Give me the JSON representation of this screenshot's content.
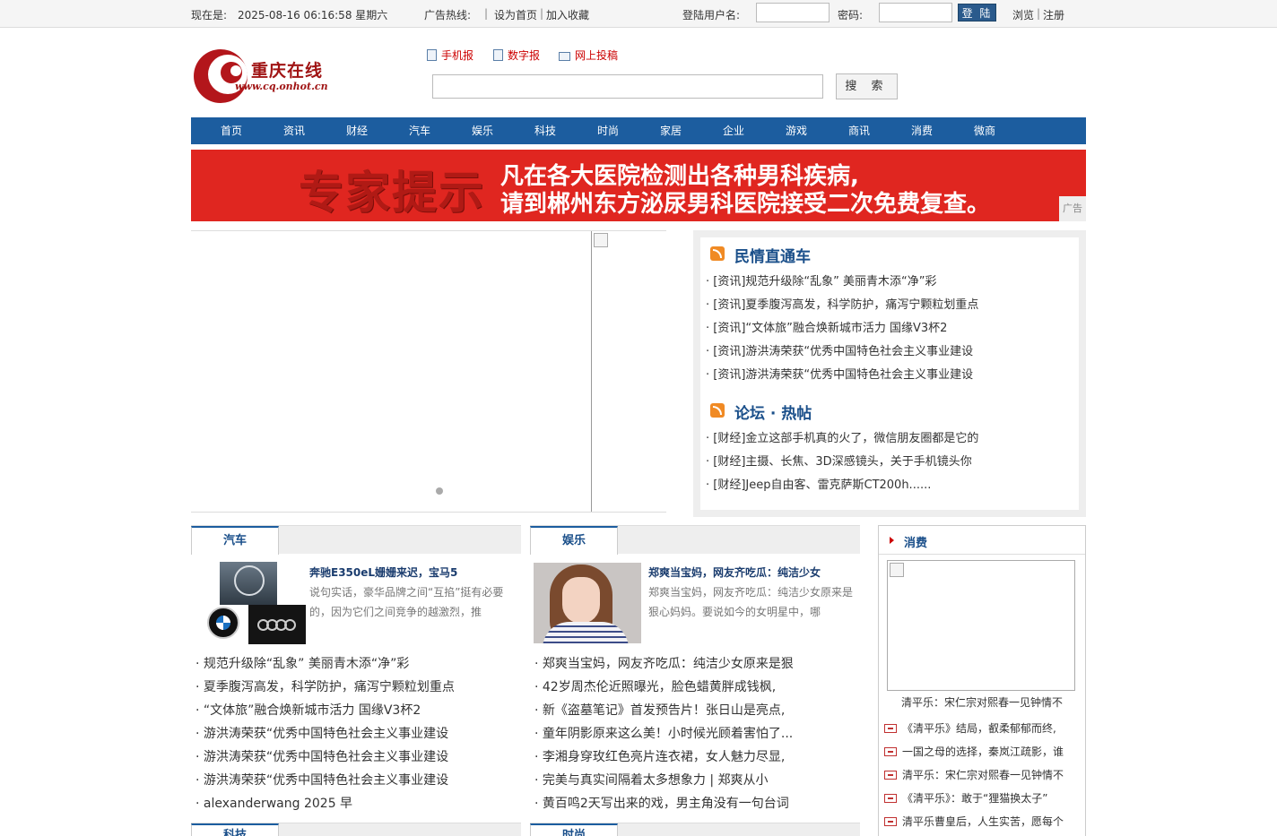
{
  "topbar": {
    "now_label": "现在是:",
    "datetime": "2025-08-16 06:16:58 星期六",
    "hotline_label": "广告热线:",
    "pipe": "|",
    "set_home": "设为首页",
    "pipe2": "|",
    "add_fav": "加入收藏",
    "username_label": "登陆用户名:",
    "username_value": "",
    "password_label": "密码:",
    "password_value": "",
    "login_button": "登 陆",
    "browse": "浏览",
    "pipe3": "|",
    "register": "注册"
  },
  "header": {
    "logo_text": "重庆在线",
    "logo_url": "www.cq.onhot.cn",
    "links": [
      {
        "label": "手机报",
        "icon": "phone-icon"
      },
      {
        "label": "数字报",
        "icon": "newspaper-icon"
      },
      {
        "label": "网上投稿",
        "icon": "mail-icon"
      }
    ],
    "search_value": "",
    "search_button": "搜 索"
  },
  "nav": [
    "首页",
    "资讯",
    "财经",
    "汽车",
    "娱乐",
    "科技",
    "时尚",
    "家居",
    "企业",
    "游戏",
    "商讯",
    "消费",
    "微商"
  ],
  "banner": {
    "big": "专家提示",
    "line1": "凡在各大医院检测出各种男科疾病,",
    "line2": "请到郴州东方泌尿男科医院接受二次免费复查。",
    "ad_tag": "广告"
  },
  "minqing": {
    "title": "民情直通车",
    "items": [
      "· [资讯]规范升级除“乱象” 美丽青木添“净”彩",
      "· [资讯]夏季腹泻高发，科学防护，痛泻宁颗粒划重点",
      "· [资讯]“文体旅”融合焕新城市活力 国缘V3杯2",
      "· [资讯]游洪涛荣获“优秀中国特色社会主义事业建设",
      "· [资讯]游洪涛荣获“优秀中国特色社会主义事业建设"
    ]
  },
  "luntan": {
    "title": "论坛 · 热帖",
    "items": [
      "· [财经]金立这部手机真的火了，微信朋友圈都是它的",
      "· [财经]主摄、长焦、3D深感镜头，关于手机镜头你",
      "· [财经]Jeep自由客、雷克萨斯CT200h......"
    ]
  },
  "qiche": {
    "tab": "汽车",
    "feature_title": "奔驰E350eL姗姗来迟，宝马5",
    "feature_desc": "说句实话，豪华品牌之间“互掐”挺有必要的，因为它们之间竞争的越激烈，推",
    "items": [
      "· 规范升级除“乱象” 美丽青木添“净”彩",
      "· 夏季腹泻高发，科学防护，痛泻宁颗粒划重点",
      "· “文体旅”融合焕新城市活力 国缘V3杯2",
      "· 游洪涛荣获“优秀中国特色社会主义事业建设",
      "· 游洪涛荣获“优秀中国特色社会主义事业建设",
      "· 游洪涛荣获“优秀中国特色社会主义事业建设",
      "· alexanderwang 2025 早"
    ]
  },
  "yule": {
    "tab": "娱乐",
    "feature_title": "郑爽当宝妈，网友齐吃瓜：纯洁少女",
    "feature_desc": "郑爽当宝妈，网友齐吃瓜：纯洁少女原来是狠心妈妈。要说如今的女明星中，哪",
    "items": [
      "· 郑爽当宝妈，网友齐吃瓜：纯洁少女原来是狠",
      "· 42岁周杰伦近照曝光，脸色蜡黄胖成钱枫,",
      "· 新《盗墓笔记》首发预告片！张日山是亮点,",
      "· 童年阴影原来这么美！小时候光顾着害怕了...",
      "· 李湘身穿玫红色亮片连衣裙，女人魅力尽显,",
      "· 完美与真实间隔着太多想象力 | 郑爽从小",
      "· 黄百鸣2天写出来的戏，男主角没有一句台词"
    ]
  },
  "xiaofei": {
    "title": "消费",
    "caption": "清平乐：宋仁宗对熙春一见钟情不",
    "items": [
      "《清平乐》结局，叡柔郁郁而终,",
      "一国之母的选择，秦岚江疏影，谁",
      "清平乐：宋仁宗对熙春一见钟情不",
      "《清平乐》：敢于“狸猫换太子”",
      "清平乐曹皇后，人生实苦，愿每个"
    ]
  },
  "row2_tabs": [
    "科技",
    "时尚"
  ]
}
